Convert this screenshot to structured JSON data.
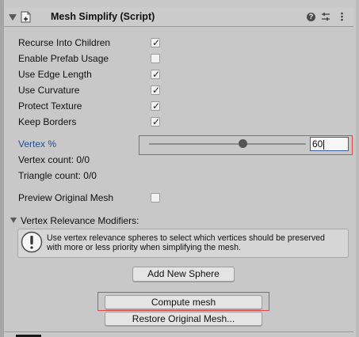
{
  "header": {
    "title": "Mesh Simplify (Script)",
    "component_icon": "script-icon",
    "help_icon": "help-icon",
    "presets_icon": "sliders-icon",
    "menu_icon": "kebab-menu-icon"
  },
  "options": [
    {
      "label": "Recurse Into Children",
      "checked": true
    },
    {
      "label": "Enable Prefab Usage",
      "checked": false
    },
    {
      "label": "Use Edge Length",
      "checked": true
    },
    {
      "label": "Use Curvature",
      "checked": true
    },
    {
      "label": "Protect Texture",
      "checked": true
    },
    {
      "label": "Keep Borders",
      "checked": true
    }
  ],
  "vertex_percent": {
    "label": "Vertex %",
    "value": "60",
    "slider_fraction": 0.6
  },
  "stats": {
    "vertex_count": "Vertex count: 0/0",
    "triangle_count": "Triangle count: 0/0"
  },
  "preview": {
    "label": "Preview Original Mesh",
    "checked": false
  },
  "modifiers": {
    "foldout_label": "Vertex Relevance Modifiers:",
    "info_icon": "info-icon",
    "info_line1": "Use vertex relevance spheres to select which vertices should be preserved",
    "info_line2": "with more or less priority when simplifying the mesh.",
    "add_button": "Add New Sphere"
  },
  "actions": {
    "compute_button": "Compute mesh",
    "restore_button": "Restore Original Mesh..."
  },
  "colors": {
    "highlight_label": "#1f4e9a",
    "red_outline": "#e04848"
  }
}
